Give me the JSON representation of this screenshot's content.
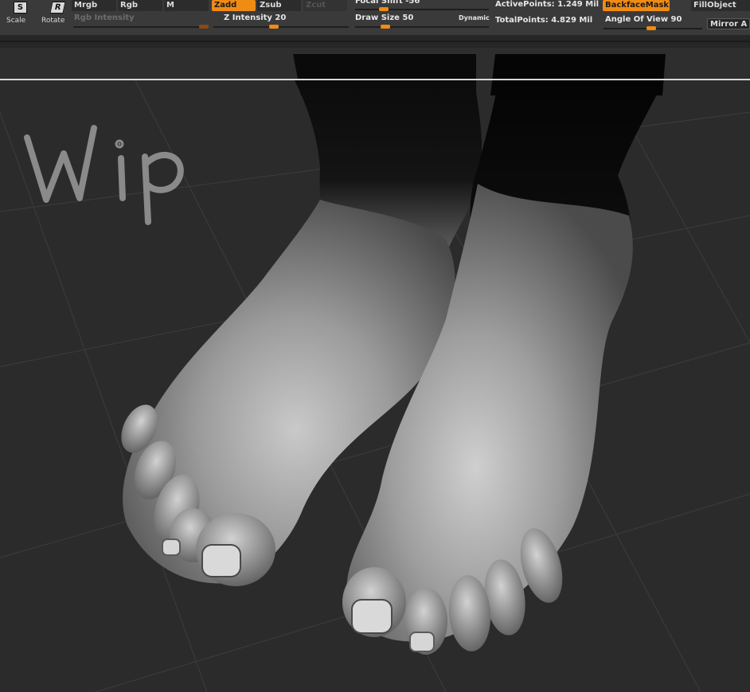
{
  "toolbar": {
    "tools": [
      {
        "label": "Scale",
        "glyph": "S"
      },
      {
        "label": "Rotate",
        "glyph": "R"
      }
    ],
    "mrgb": "Mrgb",
    "rgb": "Rgb",
    "m": "M",
    "rgb_intensity": "Rgb Intensity",
    "zadd": "Zadd",
    "zsub": "Zsub",
    "zcut": "Zcut",
    "z_intensity": "Z Intensity 20",
    "focal_shift": "Focal Shift -56",
    "draw_size": "Draw Size 50",
    "dynamic": "Dynamic",
    "active_points": "ActivePoints: 1.249 Mil",
    "total_points": "TotalPoints: 4.829 Mil",
    "backface_mask": "BackfaceMask",
    "angle_of_view": "Angle Of View 90",
    "fill_object": "FillObject",
    "mirror": "Mirror A"
  },
  "viewport": {
    "annotation": "Wip",
    "subject": "sculpted feet"
  },
  "colors": {
    "accent": "#f08b14",
    "toolbar_bg": "#3a3a3a",
    "canvas_bg": "#2b2b2b"
  }
}
